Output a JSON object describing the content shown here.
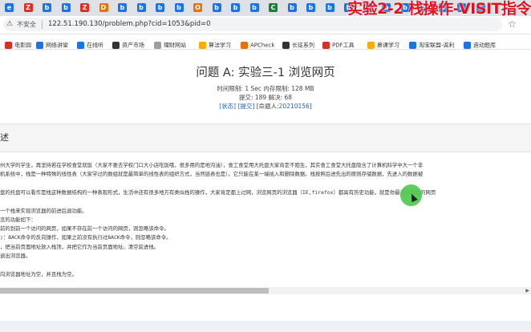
{
  "overlay": {
    "title": "实验2-2 栈操作-VISIT指令"
  },
  "tab_icons": [
    {
      "glyph": "e",
      "color": "#1a73e8"
    },
    {
      "glyph": "Z",
      "color": "#d93025"
    },
    {
      "glyph": "b",
      "color": "#1a73e8"
    },
    {
      "glyph": "b",
      "color": "#1a73e8"
    },
    {
      "glyph": "Z",
      "color": "#d93025"
    },
    {
      "glyph": "D",
      "color": "#e8710a"
    },
    {
      "glyph": "b",
      "color": "#1a73e8"
    },
    {
      "glyph": "b",
      "color": "#1a73e8"
    },
    {
      "glyph": "b",
      "color": "#1a73e8"
    },
    {
      "glyph": "b",
      "color": "#1a73e8"
    },
    {
      "glyph": "O",
      "color": "#e8710a"
    },
    {
      "glyph": "b",
      "color": "#1a73e8"
    },
    {
      "glyph": "b",
      "color": "#1a73e8"
    },
    {
      "glyph": "b",
      "color": "#1a73e8"
    },
    {
      "glyph": "C",
      "color": "#188038"
    },
    {
      "glyph": "b",
      "color": "#1a73e8"
    },
    {
      "glyph": "b",
      "color": "#1a73e8"
    },
    {
      "glyph": "b",
      "color": "#1a73e8"
    },
    {
      "glyph": "b",
      "color": "#1a73e8"
    },
    {
      "glyph": "b",
      "color": "#1a73e8"
    },
    {
      "glyph": "b",
      "color": "#1a73e8"
    },
    {
      "glyph": "b",
      "color": "#1a73e8"
    },
    {
      "glyph": "b",
      "color": "#1a73e8"
    },
    {
      "glyph": "b",
      "color": "#1a73e8"
    },
    {
      "glyph": "b",
      "color": "#1a73e8"
    },
    {
      "glyph": "b",
      "color": "#1a73e8"
    }
  ],
  "address": {
    "warning_icon": "warning-icon",
    "warning_label": "不安全",
    "url": "122.51.190.130/problem.php?cid=1053&pid=0"
  },
  "bookmarks": [
    {
      "label": "电影园",
      "color": "#d93025"
    },
    {
      "label": "网络讲堂",
      "color": "#1a73e8"
    },
    {
      "label": "在线听",
      "color": "#1a73e8"
    },
    {
      "label": "资产市场",
      "color": "#333333"
    },
    {
      "label": "理财网站",
      "color": "#9e9e9e"
    },
    {
      "label": "算法学习",
      "color": "#f9ab00"
    },
    {
      "label": "APCheck",
      "color": "#e8710a"
    },
    {
      "label": "长征系列",
      "color": "#333333"
    },
    {
      "label": "PDF工具",
      "color": "#d93025"
    },
    {
      "label": "慕课学习",
      "color": "#f9ab00"
    },
    {
      "label": "淘宝联盟-返利",
      "color": "#1a73e8"
    },
    {
      "label": "造动题库",
      "color": "#1a73e8"
    }
  ],
  "problem": {
    "title": "问题 A: 实验三-1 浏览网页",
    "limits": "时间限制: 1 Sec  内存限制: 128 MB",
    "stats": "提交: 189  解决: 68",
    "status_link": "[状态]",
    "submit_link": "[提交]",
    "creator_prefix": "[命题人:",
    "creator": "20210156",
    "creator_suffix": "]"
  },
  "section": {
    "heading": "述"
  },
  "description_lines": [
    "州大学的学生，再坚持若在学校食堂就饭（大家不要去学校门口大小店吃饭哦，很多用的是地沟油），食工食堂用大托盘大家肯定不陌生，其实食工食堂大托盘隐含了计算机科学中大一个非",
    "机系统中，栈是一种特殊的线性表（大家学过的数组就是最简单的线性表的组织方式，当然链表也是）。它只能在某一端插入和删除数据。栈按照后进先出的原则存储数据，先进入的数据被",
    "",
    "盘的托盘可以看作是栈这种数据结构的一种表现形式，生活中还有很多地方有类似栈的操作，大家肯定都上过网，浏览网页的浏览器（IE,firefox）都具有历史功能，就是你最近访问过的网页",
    "",
    "一个栈来实现浏览器的前进后退功能。",
    "览的功能如下：",
    "前的到前一个访问的网页，如果不存在前一个访问的网页，则忽略该命令。",
    ")：BACK命令的反向操作，如果之前没有执行过BACK命令，则忽略该命令。",
    "，把当前页面地址放入栈顶，并把它作为当前页面地址。清空前进栈。",
    "退出浏览器。",
    "",
    "向浏览器地址为空，并且栈为空。"
  ]
}
